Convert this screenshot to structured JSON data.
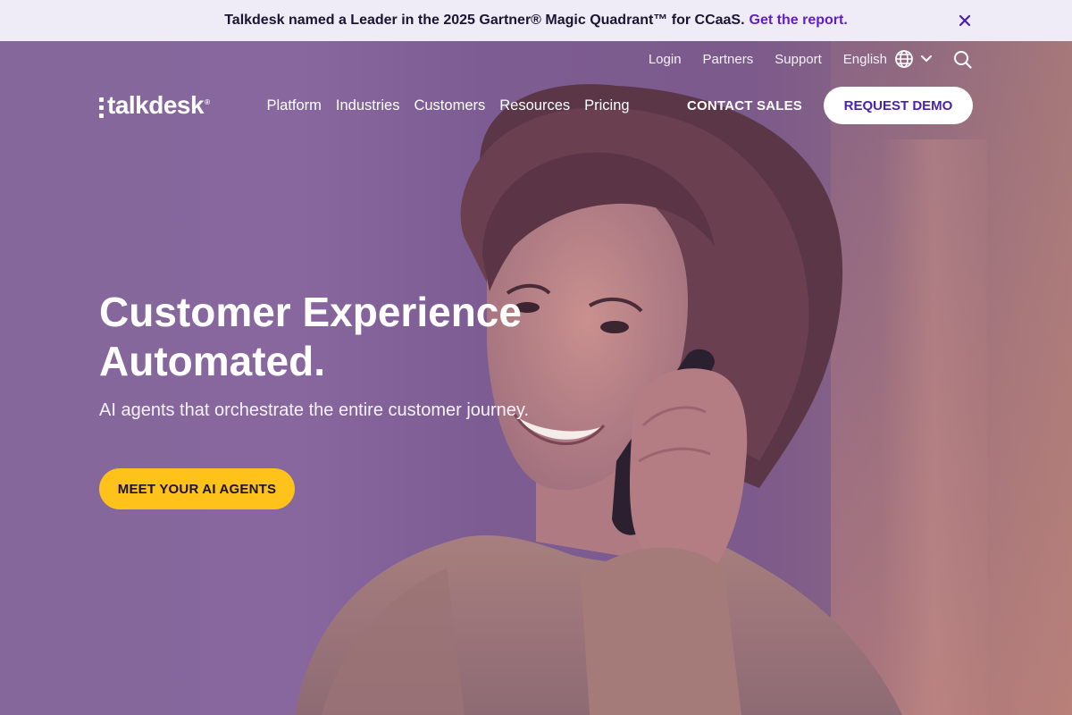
{
  "announcement": {
    "text": "Talkdesk named a Leader in the 2025 Gartner® Magic Quadrant™ for CCaaS.",
    "link": "Get the report.",
    "close_icon": "close-icon",
    "link_color": "#5f1ec8"
  },
  "utility_nav": {
    "login": "Login",
    "partners": "Partners",
    "support": "Support",
    "language": "English",
    "globe_icon": "globe-icon",
    "chevron_icon": "chevron-down-icon",
    "search_icon": "search-icon"
  },
  "main_nav": {
    "logo": "talkdesk",
    "items": [
      "Platform",
      "Industries",
      "Customers",
      "Resources",
      "Pricing"
    ],
    "contact_sales": "CONTACT SALES",
    "request_demo": "REQUEST DEMO"
  },
  "hero": {
    "headline_line1": "Customer Experience",
    "headline_line2": "Automated.",
    "subheadline": "AI agents that orchestrate the entire customer journey.",
    "cta": "MEET YOUR AI AGENTS",
    "cta_color": "#ffc21a"
  }
}
